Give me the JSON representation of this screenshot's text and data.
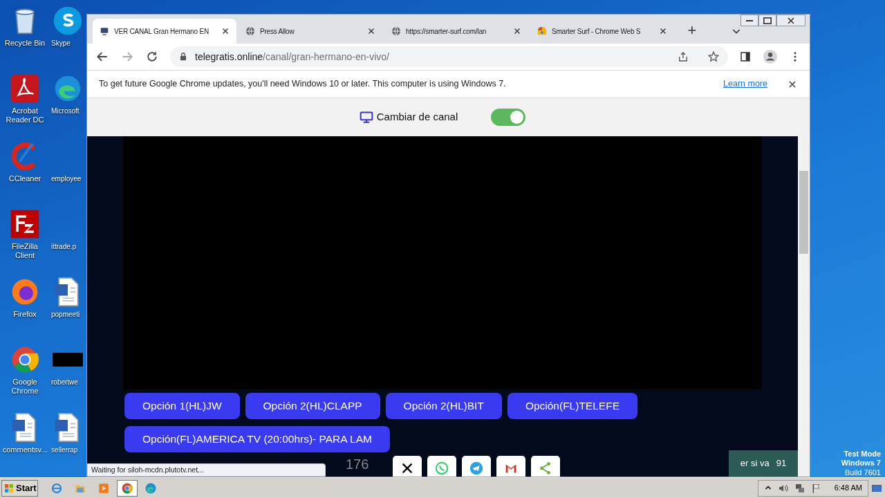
{
  "desktop": {
    "columns": [
      {
        "icons": [
          {
            "label": "Recycle Bin",
            "kind": "recycle"
          },
          {
            "label": "Acrobat Reader DC",
            "kind": "pdf"
          },
          {
            "label": "CCleaner",
            "kind": "ccleaner"
          },
          {
            "label": "FileZilla Client",
            "kind": "filezilla"
          },
          {
            "label": "Firefox",
            "kind": "firefox"
          },
          {
            "label": "Google Chrome",
            "kind": "chrome"
          },
          {
            "label": "commentsv...",
            "kind": "word"
          }
        ]
      },
      {
        "icons": [
          {
            "label": "Skype",
            "kind": "skype"
          },
          {
            "label": "Microsoft",
            "kind": "edge"
          },
          {
            "label": "employee",
            "kind": "none"
          },
          {
            "label": "ittrade.p",
            "kind": "none"
          },
          {
            "label": "popmeeti",
            "kind": "word"
          },
          {
            "label": "robertwe",
            "kind": "black"
          },
          {
            "label": "sellerrap",
            "kind": "word"
          }
        ]
      }
    ],
    "system_note": [
      "Test Mode",
      "Windows 7",
      "Build 7601"
    ]
  },
  "browser": {
    "tabs": [
      {
        "title": "VER CANAL Gran Hermano EN",
        "kind": "tv",
        "selected": true
      },
      {
        "title": "Press Allow",
        "kind": "globe",
        "selected": false
      },
      {
        "title": "https://smarter-surf.com/lan",
        "kind": "globe",
        "selected": false
      },
      {
        "title": "Smarter Surf - Chrome Web S",
        "kind": "store",
        "selected": false
      }
    ],
    "new_tab": "+",
    "address": {
      "host": "telegratis.online",
      "path": "/canal/gran-hermano-en-vivo/"
    },
    "infobar": {
      "text": "To get future Google Chrome updates, you'll need Windows 10 or later. This computer is using Windows 7.",
      "link": "Learn more"
    },
    "page": {
      "channel_switch": {
        "label": "Cambiar de canal",
        "on": true
      },
      "options": [
        {
          "label": "Opción 1(HL)JW"
        },
        {
          "label": "Opción 2(HL)CLAPP"
        },
        {
          "label": "Opción 2(HL)BIT"
        },
        {
          "label": "Opción(FL)TELEFE"
        },
        {
          "label": "Opción(FL)AMERICA TV (20:00hrs)- PARA LAM"
        }
      ],
      "share_count": "176",
      "share_buttons": [
        {
          "kind": "x"
        },
        {
          "kind": "whatsapp"
        },
        {
          "kind": "telegram"
        },
        {
          "kind": "gmail"
        },
        {
          "kind": "share"
        }
      ],
      "side_widget": {
        "text": "er si va",
        "count": "91"
      }
    },
    "status": "Waiting for siloh-mcdn.plutotv.net..."
  },
  "taskbar": {
    "start": "Start",
    "apps": [
      {
        "kind": "ie",
        "selected": false
      },
      {
        "kind": "folder",
        "selected": false
      },
      {
        "kind": "media",
        "selected": false
      },
      {
        "kind": "chrome",
        "selected": true
      },
      {
        "kind": "edge",
        "selected": false
      }
    ],
    "time": "6:48 AM"
  }
}
